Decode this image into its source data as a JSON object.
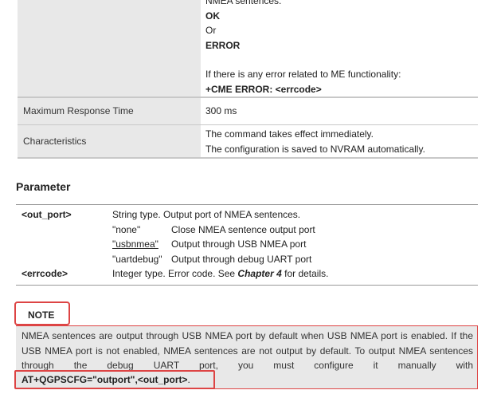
{
  "response": {
    "lines": [
      "NMEA sentences.",
      "OK",
      "Or",
      "ERROR",
      "If there is any error related to ME functionality:",
      "+CME ERROR: <errcode>"
    ]
  },
  "rows": [
    {
      "label": "Maximum Response Time",
      "value_lines": [
        "300 ms"
      ]
    },
    {
      "label": "Characteristics",
      "value_lines": [
        "The command takes effect immediately.",
        "The configuration is saved to NVRAM automatically."
      ]
    }
  ],
  "parameter": {
    "heading": "Parameter",
    "out_port": {
      "name": "<out_port>",
      "desc": "String type. Output port of NMEA sentences.",
      "options": [
        {
          "key": "\"none\"",
          "desc": "Close NMEA sentence output port"
        },
        {
          "key": "\"usbnmea\"",
          "desc": "Output through USB NMEA port"
        },
        {
          "key": "\"uartdebug\"",
          "desc": "Output through debug UART port"
        }
      ]
    },
    "errcode": {
      "name": "<errcode>",
      "desc_prefix": "Integer type. Error code. See ",
      "desc_ref": "Chapter 4",
      "desc_suffix": " for details."
    }
  },
  "note": {
    "label": "NOTE",
    "text": "NMEA sentences are output through USB NMEA port by default when USB NMEA port is enabled. If the USB NMEA port is not enabled, NMEA sentences are not output by default. To output NMEA sentences through the debug UART port, you must configure it manually with",
    "command": "AT+QGPSCFG=\"outport\",<out_port>",
    "command_end": "."
  },
  "colors": {
    "label_bg": "#e8e8e8",
    "highlight_red": "#dd4444"
  }
}
